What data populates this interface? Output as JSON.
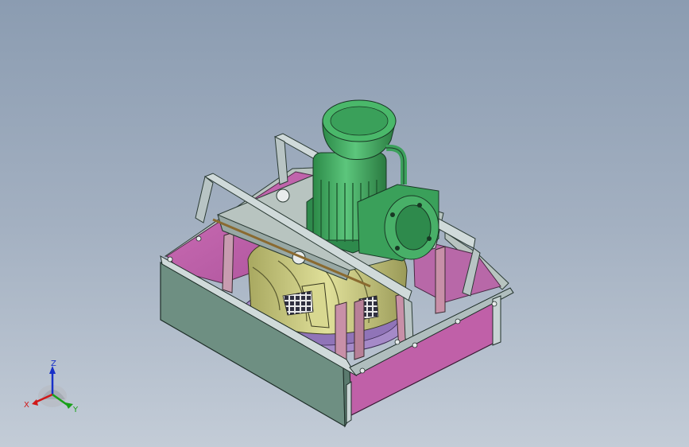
{
  "triad": {
    "z_label": "Z",
    "x_label": "X",
    "y_label": "Y",
    "colors": {
      "x": "#d01818",
      "y": "#18a018",
      "z": "#1830c8"
    }
  },
  "colors": {
    "background_top": "#8b9cb1",
    "background_bottom": "#c3ccd7",
    "housing_panel": "#6e8f82",
    "housing_inner": "#c060a8",
    "motor": "#3fa660",
    "impeller": "#c8c878",
    "inlet_ring": "#a080c0",
    "frame": "#a8b8b8"
  }
}
